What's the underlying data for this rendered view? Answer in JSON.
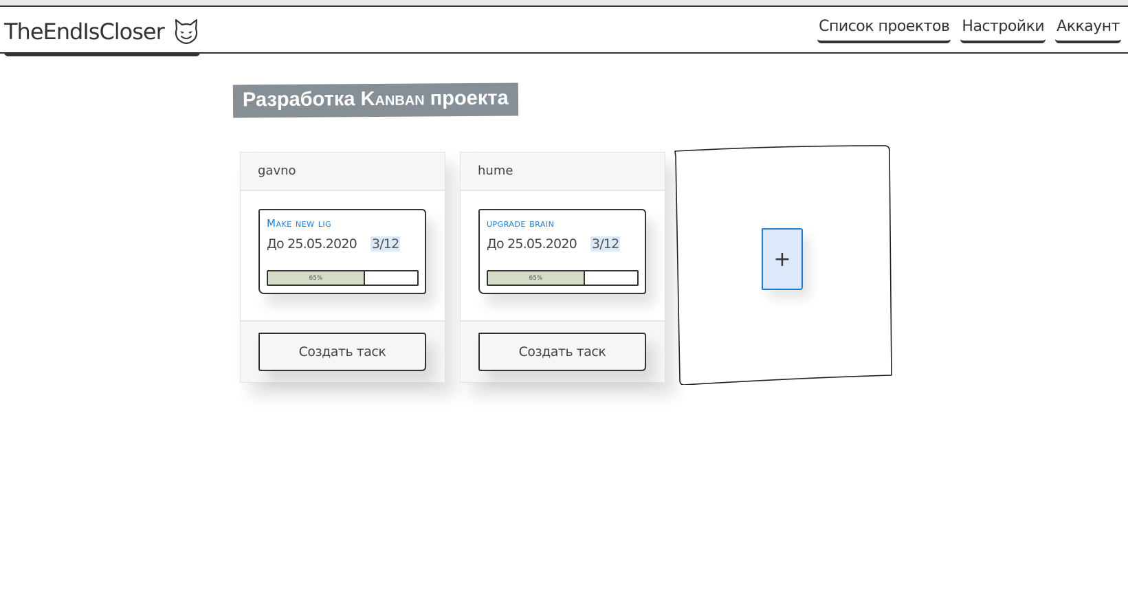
{
  "navbar": {
    "brand": "TheEndIsCloser",
    "brand_icon": "cat-face-icon",
    "links": [
      {
        "label": "Список проектов"
      },
      {
        "label": "Настройки"
      },
      {
        "label": "Аккаунт"
      }
    ]
  },
  "page": {
    "title_prefix": "Разработка ",
    "title_highlight": "Kanban",
    "title_suffix": " проекта",
    "title_bg": "#868e96"
  },
  "columns": [
    {
      "name": "gavno",
      "tasks": [
        {
          "title": "Make new lig",
          "due": "До 25.05.2020",
          "count": "3/12",
          "progress_label": "65%",
          "progress": 0.65
        }
      ],
      "create_label": "Создать таск"
    },
    {
      "name": "hume",
      "tasks": [
        {
          "title": "upgrade brain",
          "due": "До 25.05.2020",
          "count": "3/12",
          "progress_label": "65%",
          "progress": 0.65
        }
      ],
      "create_label": "Создать таск"
    }
  ],
  "add_column": {
    "label": "+",
    "accent": "#1c7ed6",
    "fill": "#dbe9fb"
  },
  "colors": {
    "task_title": "#1c7ed6",
    "progress_fill": "#d3dcc4",
    "count_bg": "#dbe9fb"
  }
}
